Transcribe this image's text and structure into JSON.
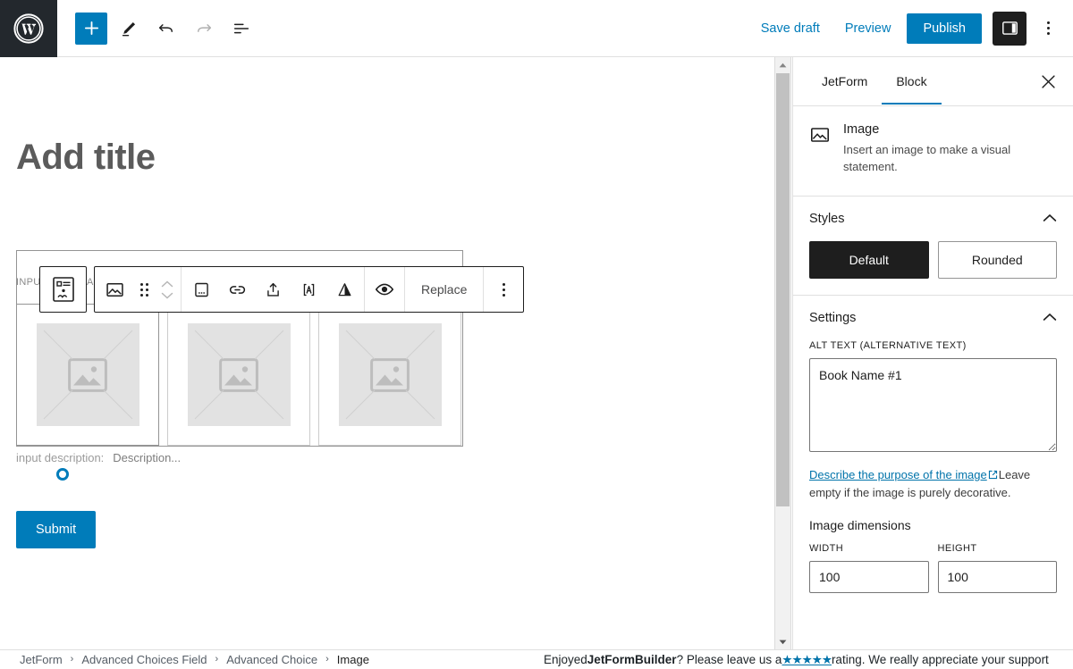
{
  "topbar": {
    "logo_icon": "wordpress-logo-icon",
    "add_block_icon": "plus-icon",
    "edit_icon": "pencil-icon",
    "undo_icon": "undo-arrow-icon",
    "redo_icon": "redo-arrow-icon",
    "list_view_icon": "list-view-icon",
    "save_draft_label": "Save draft",
    "preview_label": "Preview",
    "publish_label": "Publish",
    "sidebar_toggle_icon": "settings-sidebar-icon",
    "options_icon": "vertical-dots-icon",
    "accent_color": "#007cba"
  },
  "editor": {
    "title_placeholder": "Add title",
    "input_label_fragment": "INPU",
    "input_label_fragment2": "A",
    "choices": [
      {
        "alt": "image-placeholder",
        "selected": true
      },
      {
        "alt": "image-placeholder",
        "selected": false
      },
      {
        "alt": "image-placeholder",
        "selected": false
      }
    ],
    "description_label": "input description:",
    "description_value": "Description...",
    "submit_label": "Submit"
  },
  "block_toolbar": {
    "parent_block_icon": "form-input-field-icon",
    "block_type_icon": "image-block-icon",
    "drag_handle_icon": "drag-handle-dots-icon",
    "move_up_icon": "chevron-up-icon",
    "move_down_icon": "chevron-down-icon",
    "caption_icon": "add-caption-icon",
    "link_icon": "link-icon",
    "crop_icon": "crop-upload-icon",
    "text_overlay_icon": "add-text-over-image-icon",
    "filter_icon": "duotone-filter-icon",
    "preview_icon": "eye-preview-icon",
    "replace_label": "Replace",
    "more_options_icon": "vertical-dots-icon"
  },
  "sidebar": {
    "tabs": [
      {
        "label": "JetForm",
        "active": false
      },
      {
        "label": "Block",
        "active": true
      }
    ],
    "close_icon": "close-x-icon",
    "block": {
      "icon": "image-block-icon",
      "name": "Image",
      "description": "Insert an image to make a visual statement."
    },
    "styles": {
      "title": "Styles",
      "collapse_icon": "chevron-up-icon",
      "options": [
        {
          "label": "Default",
          "active": true
        },
        {
          "label": "Rounded",
          "active": false
        }
      ]
    },
    "settings": {
      "title": "Settings",
      "collapse_icon": "chevron-up-icon",
      "alt_text_label": "ALT TEXT (ALTERNATIVE TEXT)",
      "alt_text_value": "Book Name #1",
      "alt_text_placeholder": "",
      "help_link_text": "Describe the purpose of the image",
      "help_link_icon": "external-link-icon",
      "help_text": "Leave empty if the image is purely decorative.",
      "dimensions_title": "Image dimensions",
      "width_label": "WIDTH",
      "width_value": "100",
      "height_label": "HEIGHT",
      "height_value": "100"
    }
  },
  "bottombar": {
    "breadcrumb": [
      {
        "label": "JetForm"
      },
      {
        "label": "Advanced Choices Field"
      },
      {
        "label": "Advanced Choice"
      },
      {
        "label": "Image"
      }
    ],
    "separator": "›",
    "rating_prefix": "Enjoyed ",
    "rating_brand": "JetFormBuilder",
    "rating_mid": "? Please leave us a ",
    "rating_stars": "★★★★★",
    "rating_suffix": " rating. We really appreciate your support"
  },
  "scrollbar": {
    "up_icon": "scroll-up-arrow-icon",
    "down_icon": "scroll-down-arrow-icon"
  }
}
